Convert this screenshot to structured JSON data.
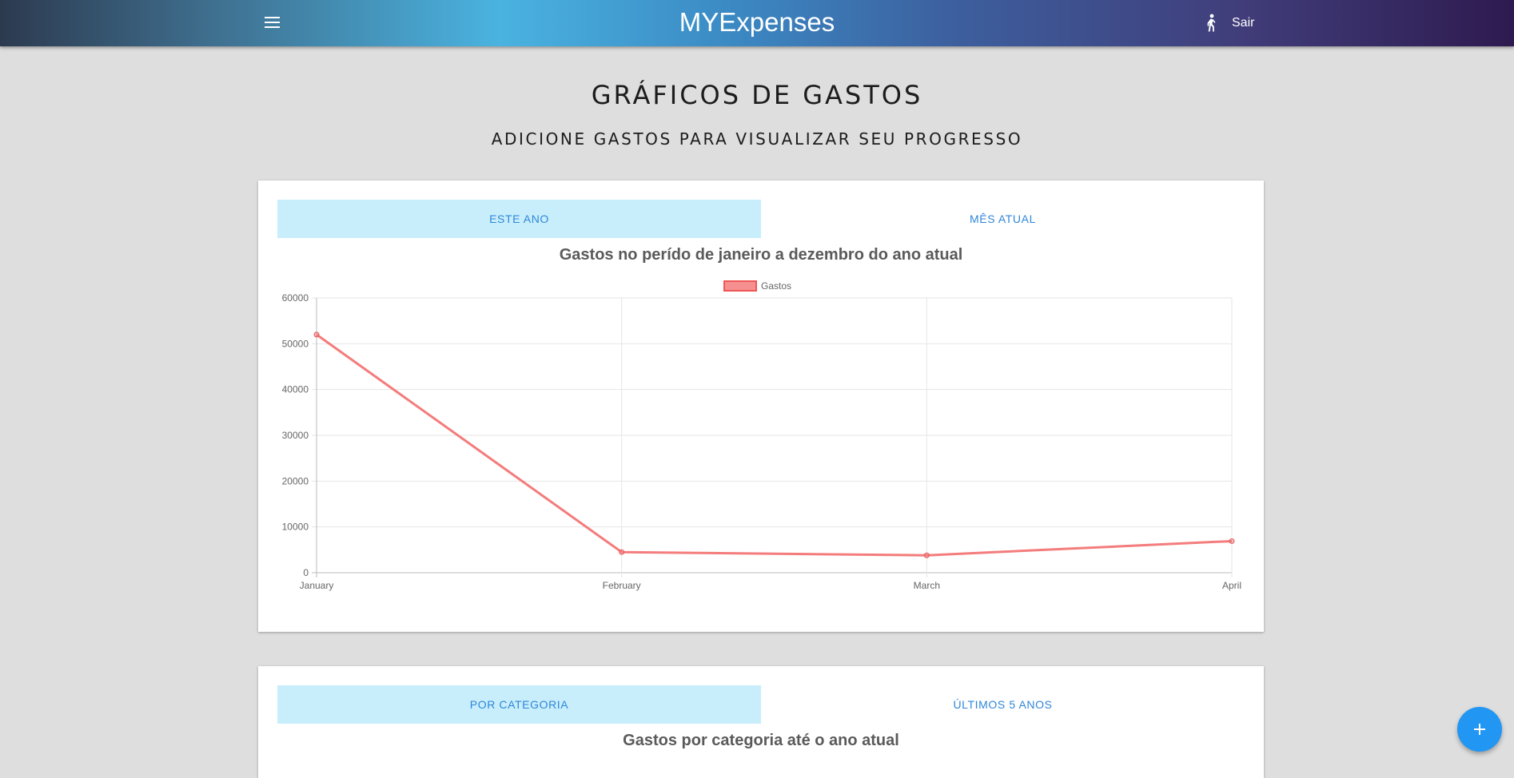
{
  "header": {
    "app_title": "MYExpenses",
    "menu_icon": "menu-icon",
    "logout_icon": "walking-person-icon",
    "logout_label": "Sair"
  },
  "page": {
    "title": "GRÁFICOS DE GASTOS",
    "subtitle": "ADICIONE GASTOS PARA VISUALIZAR SEU PROGRESSO"
  },
  "card_yearly": {
    "tabs": [
      {
        "label": "ESTE ANO",
        "active": true
      },
      {
        "label": "MÊS ATUAL",
        "active": false
      }
    ]
  },
  "card_category": {
    "tabs": [
      {
        "label": "POR CATEGORIA",
        "active": true
      },
      {
        "label": "ÚLTIMOS 5 ANOS",
        "active": false
      }
    ],
    "chart_title": "Gastos por categoria até o ano atual"
  },
  "fab": {
    "icon": "plus-icon"
  },
  "colors": {
    "tab_active_bg": "#c8eefc",
    "tab_text": "#2f86d8",
    "line": "#f47c7c",
    "fab": "#2196f3"
  },
  "chart_data": {
    "type": "line",
    "title": "Gastos no perído de janeiro a dezembro do ano atual",
    "xlabel": "",
    "ylabel": "",
    "categories": [
      "January",
      "February",
      "March",
      "April"
    ],
    "series": [
      {
        "name": "Gastos",
        "values": [
          52000,
          4500,
          3800,
          6900
        ]
      }
    ],
    "yticks": [
      0,
      10000,
      20000,
      30000,
      40000,
      50000,
      60000
    ],
    "ylim": [
      0,
      60000
    ],
    "grid": true,
    "legend": "top"
  }
}
